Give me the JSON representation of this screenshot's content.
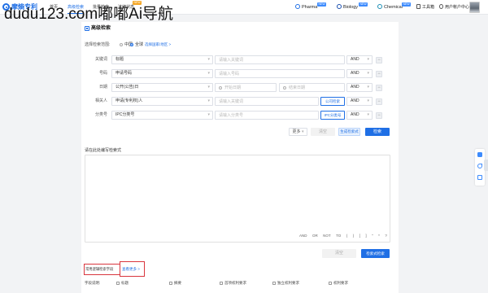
{
  "watermark": "dudu123.com嘟嘟Ai导航",
  "theme": {
    "accent": "#1f6fe5",
    "annotation_red": "#d9363e",
    "badge_orange": "#f5a623",
    "badge_blue": "#3d8bfd"
  },
  "nav": {
    "logo_text": "摩熵专利",
    "logo_icon": "logo-icon",
    "items": [
      {
        "label": "首页"
      },
      {
        "label": "高级检索",
        "active": true
      },
      {
        "label": "批量检索"
      },
      {
        "label": "法律状态",
        "badge": "NEW"
      }
    ],
    "products": [
      {
        "label": "Pharma",
        "badge": "NEW",
        "icon": "pharma-icon"
      },
      {
        "label": "Biology",
        "badge": "NEW",
        "icon": "biology-icon"
      },
      {
        "label": "Chemical",
        "badge": "NEW",
        "icon": "chemical-icon"
      }
    ],
    "toolbox": "工具箱",
    "account": "用户帐户中心"
  },
  "page": {
    "title": "高级检索",
    "scope": {
      "label": "选择检索范围:",
      "options": [
        {
          "label": "中国",
          "selected": false
        },
        {
          "label": "全球",
          "selected": true
        }
      ],
      "country_link": "选择国家/地区 >"
    }
  },
  "search": {
    "rows": [
      {
        "label": "关键词",
        "field": "标题",
        "placeholder": "请输入关键词",
        "operator": "AND"
      },
      {
        "label": "号码",
        "field": "申请号码",
        "placeholder": "请输入号码",
        "operator": "AND"
      },
      {
        "label": "日期",
        "field": "公开(公告)日",
        "start_placeholder": "开始日期",
        "end_placeholder": "结束日期",
        "operator": "AND"
      },
      {
        "label": "相关人",
        "field": "申请(专利权)人",
        "placeholder": "请输入关键词",
        "action": "公司检索",
        "operator": "AND"
      },
      {
        "label": "分类号",
        "field": "IPC分类号",
        "placeholder": "请输入分类号",
        "action": "IPC分类号",
        "operator": "AND"
      }
    ],
    "buttons": {
      "more": "更多",
      "clear": "清空",
      "generate": "生成检索式",
      "search": "检索"
    }
  },
  "expression": {
    "label": "请在此处编写检索式",
    "value": "",
    "operators": [
      "AND",
      "OR",
      "NOT",
      "TO",
      "(",
      ")",
      "[",
      "]",
      "\"",
      "*",
      "?"
    ],
    "clear_button": "清空",
    "search_button": "检索式检索"
  },
  "help": {
    "common_fields": "常用逻辑检索字段",
    "more_link": "查看更多 >",
    "field_desc_label": "字段说明:",
    "fields": [
      "标题",
      "摘要",
      "首项权利要求",
      "独立权利要求",
      "权利要求"
    ]
  },
  "side_tools": [
    "chat-icon",
    "phone-icon",
    "message-icon"
  ]
}
